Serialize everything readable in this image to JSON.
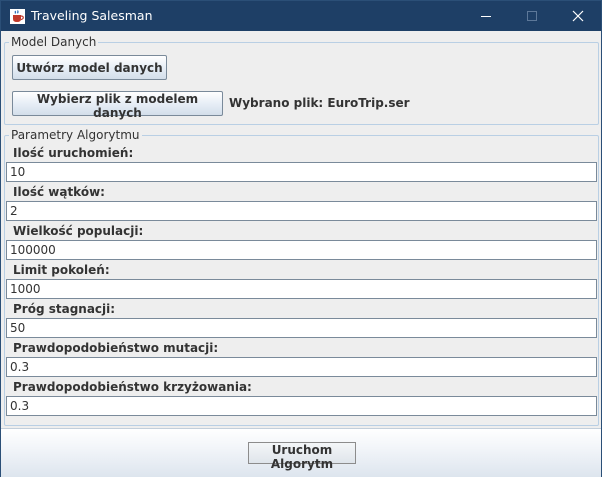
{
  "window": {
    "title": "Traveling Salesman",
    "icon": "java-cup-icon",
    "controls": [
      "minimize-icon",
      "maximize-icon",
      "close-icon"
    ]
  },
  "model_group": {
    "legend": "Model Danych",
    "create_button": "Utwórz model danych",
    "choose_file_button": "Wybierz plik z modelem danych",
    "selected_file_text": "Wybrano plik: EuroTrip.ser"
  },
  "params_group": {
    "legend": "Parametry Algorytmu",
    "fields": [
      {
        "label": "Ilość uruchomień:",
        "value": "10"
      },
      {
        "label": "Ilość wątków:",
        "value": "2"
      },
      {
        "label": "Wielkość populacji:",
        "value": "100000"
      },
      {
        "label": "Limit pokoleń:",
        "value": "1000"
      },
      {
        "label": "Próg stagnacji:",
        "value": "50"
      },
      {
        "label": "Prawdopodobieństwo mutacji:",
        "value": "0.3"
      },
      {
        "label": "Prawdopodobieństwo krzyżowania:",
        "value": "0.3"
      }
    ]
  },
  "run_button": "Uruchom Algorytm",
  "colors": {
    "titlebar": "#1e3f66",
    "window_bg": "#eeeeee",
    "border_accent": "#b9cfe4"
  }
}
